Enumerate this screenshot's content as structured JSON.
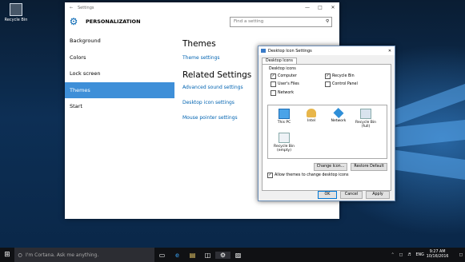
{
  "desktop": {
    "recycle_bin": "Recycle Bin"
  },
  "settings": {
    "window_title": "Settings",
    "header_title": "PERSONALIZATION",
    "search_placeholder": "Find a setting",
    "nav": [
      "Background",
      "Colors",
      "Lock screen",
      "Themes",
      "Start"
    ],
    "themes_heading": "Themes",
    "theme_settings_link": "Theme settings",
    "related_heading": "Related Settings",
    "related_links": [
      "Advanced sound settings",
      "Desktop icon settings",
      "Mouse pointer settings"
    ]
  },
  "dialog": {
    "title": "Desktop Icon Settings",
    "tab": "Desktop Icons",
    "group_label": "Desktop icons",
    "checkboxes": {
      "computer": {
        "label": "Computer",
        "checked": true
      },
      "recycle_bin": {
        "label": "Recycle Bin",
        "checked": true
      },
      "users_files": {
        "label": "User's Files",
        "checked": false
      },
      "control_panel": {
        "label": "Control Panel",
        "checked": false
      },
      "network": {
        "label": "Network",
        "checked": false
      }
    },
    "icons": [
      "This PC",
      "Intel",
      "Network",
      "Recycle Bin (full)",
      "Recycle Bin (empty)"
    ],
    "change_icon": "Change Icon...",
    "restore_default": "Restore Default",
    "allow_themes": "Allow themes to change desktop icons",
    "ok": "OK",
    "cancel": "Cancel",
    "apply": "Apply"
  },
  "taskbar": {
    "cortana_placeholder": "I'm Cortana. Ask me anything.",
    "language": "ENG",
    "time": "9:27 AM",
    "date": "10/16/2016"
  },
  "colors": {
    "accent": "#3e8fd8",
    "link": "#0063b1",
    "taskbar": "#101114"
  }
}
